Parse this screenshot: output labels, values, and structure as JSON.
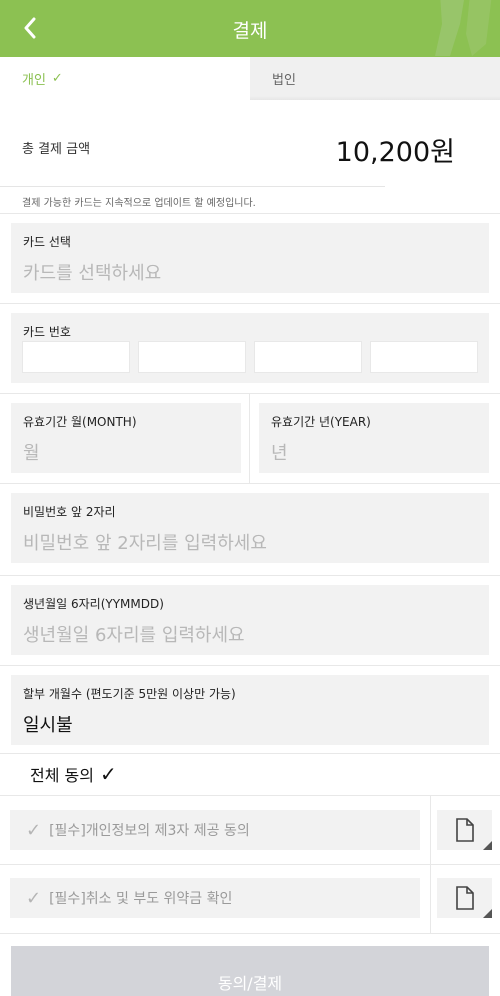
{
  "header": {
    "title": "결제",
    "back_icon": "chevron-left-icon",
    "background": "#8cc152"
  },
  "tabs": [
    {
      "label": "개인",
      "check": "✓",
      "active": true
    },
    {
      "label": "법인",
      "active": false
    }
  ],
  "payment": {
    "total_label": "총 결제 금액",
    "total_amount": "10,200원"
  },
  "notice": "결제 가능한 카드는 지속적으로 업데이트 할 예정입니다.",
  "card_select": {
    "label": "카드 선택",
    "placeholder": "카드를 선택하세요"
  },
  "card_number": {
    "label": "카드 번호"
  },
  "expiry": {
    "month_label": "유효기간 월(MONTH)",
    "month_placeholder": "월",
    "year_label": "유효기간 년(YEAR)",
    "year_placeholder": "년"
  },
  "password": {
    "label": "비밀번호 앞 2자리",
    "placeholder": "비밀번호 앞 2자리를 입력하세요"
  },
  "birth": {
    "label": "생년월일 6자리(YYMMDD)",
    "placeholder": "생년월일 6자리를 입력하세요"
  },
  "installment": {
    "label": "할부 개월수 (편도기준 5만원 이상만 가능)",
    "value": "일시불"
  },
  "agree_all": {
    "label": "전체 동의",
    "check": "✓"
  },
  "terms": [
    {
      "check": "✓",
      "label": "[필수]개인정보의 제3자 제공 동의",
      "icon": "document-icon"
    },
    {
      "check": "✓",
      "label": "[필수]취소 및 부도 위약금 확인",
      "icon": "document-icon"
    }
  ],
  "submit_label": "동의/결제"
}
